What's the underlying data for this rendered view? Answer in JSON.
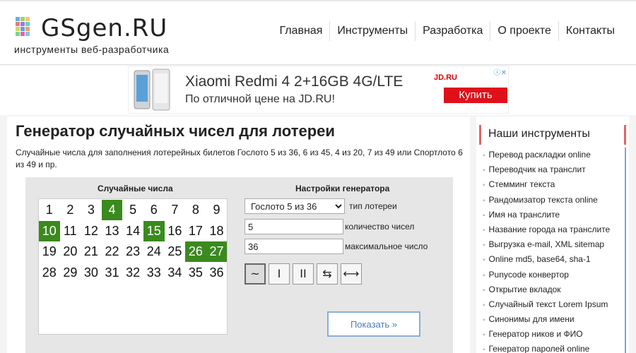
{
  "header": {
    "logo_text": "GSgen.RU",
    "tagline": "инструменты веб-разработчика",
    "nav": [
      "Главная",
      "Инструменты",
      "Разработка",
      "О проекте",
      "Контакты"
    ]
  },
  "ad": {
    "title": "Xiaomi Redmi 4 2+16GB 4G/LTE",
    "subtitle": "По отличной цене на JD.RU!",
    "logo": "JD.RU",
    "button": "Купить",
    "choices": "ⓘ✕"
  },
  "main": {
    "title": "Генератор случайных чисел для лотереи",
    "description": "Случайные числа для заполнения лотерейных билетов Гослото 5 из 36, 6 из 45, 4 из 20, 7 из 49 или Спортлото 6 из 49 и пр."
  },
  "tool": {
    "numbers_title": "Случайные числа",
    "settings_title": "Настройки генератора",
    "numbers": [
      1,
      2,
      3,
      4,
      5,
      6,
      7,
      8,
      9,
      10,
      11,
      12,
      13,
      14,
      15,
      16,
      17,
      18,
      19,
      20,
      21,
      22,
      23,
      24,
      25,
      26,
      27,
      28,
      29,
      30,
      31,
      32,
      33,
      34,
      35,
      36
    ],
    "selected": [
      4,
      10,
      15,
      26,
      27
    ],
    "lottery_type": "Гослото 5 из 36",
    "lottery_type_label": "тип лотереи",
    "count_value": "5",
    "count_label": "количество чисел",
    "max_value": "36",
    "max_label": "максимальное число",
    "mode_buttons": [
      "~",
      "I",
      "II",
      "⇆",
      "⟷"
    ],
    "show_button": "Показать »"
  },
  "sidebar": {
    "title": "Наши инструменты",
    "items": [
      "Перевод раскладки online",
      "Переводчик на транслит",
      "Стемминг текста",
      "Рандомизатор текста online",
      "Имя на транслите",
      "Название города на транслите",
      "Выгрузка e-mail, XML sitemap",
      "Online md5, base64, sha-1",
      "Punycode конвертор",
      "Открытие вкладок",
      "Случайный текст Lorem Ipsum",
      "Синонимы для имени",
      "Генератор ников и ФИО",
      "Генератор паролей online"
    ]
  },
  "colors": {
    "selected_number": "#3a8a1e",
    "ad_button": "#e0101a",
    "sidebar_accent": "#dd6666",
    "show_button_border": "#8aaed6"
  }
}
